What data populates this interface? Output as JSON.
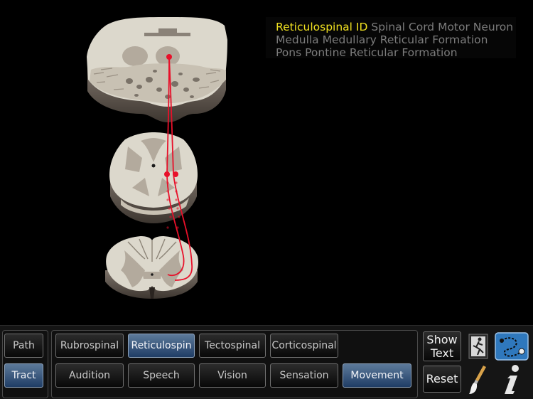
{
  "header": {
    "line1_active": "Reticulospinal ID",
    "line1_rest": "Spinal Cord Motor Neuron",
    "line2": "Medulla  Medullary Reticular Formation",
    "line3": "Pons  Pontine Reticular Formation"
  },
  "left_buttons": {
    "path": "Path",
    "tract": "Tract"
  },
  "tract_buttons": [
    "Rubrospinal",
    "Reticulospin",
    "Tectospinal",
    "Corticospinal"
  ],
  "system_buttons": [
    "Audition",
    "Speech",
    "Vision",
    "Sensation",
    "Movement"
  ],
  "right_buttons": {
    "show_text": "Show\nText",
    "show_text_l1": "Show",
    "show_text_l2": "Text",
    "reset": "Reset"
  },
  "icons": [
    "running-figure-icon",
    "pathway-drawing-icon",
    "paintbrush-icon",
    "info-icon"
  ],
  "colors": {
    "active_text": "#f0e020",
    "dim_text": "#7c7c7c",
    "tract_red": "#e8102a",
    "active_button": "#3a5a82",
    "tissue": "#ddd9cd",
    "grey_matter": "#b4ab9e"
  }
}
